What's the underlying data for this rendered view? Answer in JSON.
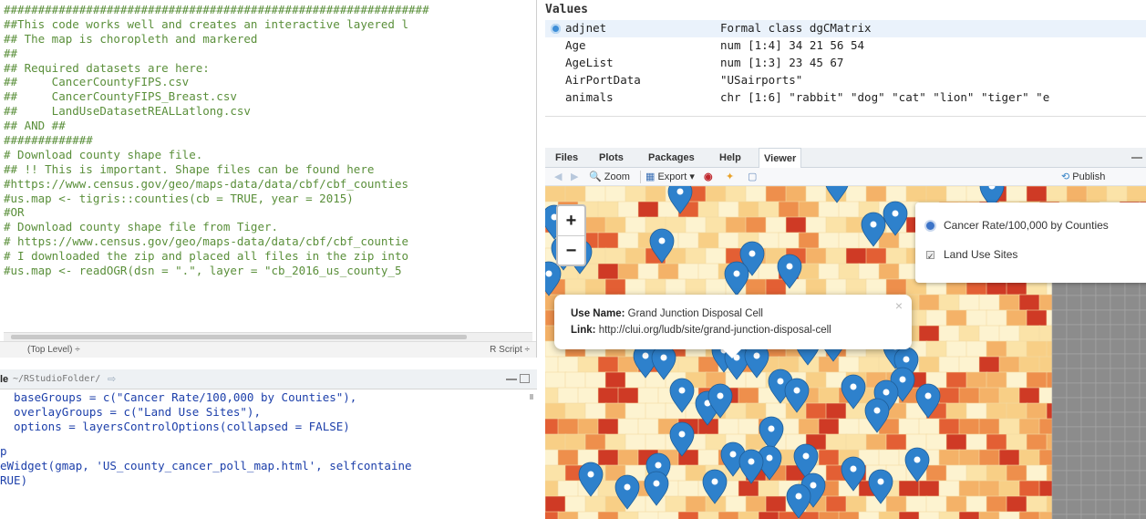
{
  "editor": {
    "lines": [
      "##############################################################",
      "##This code works well and creates an interactive layered l",
      "## The map is choropleth and markered",
      "##",
      "## Required datasets are here:",
      "##     CancerCountyFIPS.csv",
      "##     CancerCountyFIPS_Breast.csv",
      "##     LandUseDatasetREALLatlong.csv",
      "## AND ##",
      "#############",
      "# Download county shape file.",
      "## !! This is important. Shape files can be found here",
      "#https://www.census.gov/geo/maps-data/data/cbf/cbf_counties",
      "#us.map <- tigris::counties(cb = TRUE, year = 2015)",
      "#OR",
      "# Download county shape file from Tiger.",
      "# https://www.census.gov/geo/maps-data/data/cbf/cbf_countie",
      "# I downloaded the zip and placed all files in the zip into",
      "#us.map <- readOGR(dsn = \".\", layer = \"cb_2016_us_county_5"
    ],
    "scope": "(Top Level) ÷",
    "file_type": "R Script ÷"
  },
  "console": {
    "title": "le",
    "path": "~/RStudioFolder/",
    "lines_a": [
      "  baseGroups = c(\"Cancer Rate/100,000 by Counties\"),",
      "  overlayGroups = c(\"Land Use Sites\"),",
      "  options = layersControlOptions(collapsed = FALSE)"
    ],
    "lines_b": [
      "p",
      "eWidget(gmap, 'US_county_cancer_poll_map.html', selfcontaine",
      "RUE)"
    ]
  },
  "environment": {
    "header": "Values",
    "rows": [
      {
        "name": "adjnet",
        "value": "Formal class dgCMatrix"
      },
      {
        "name": "Age",
        "value": "num [1:4] 34 21 56 54"
      },
      {
        "name": "AgeList",
        "value": "num [1:3] 23 45 67"
      },
      {
        "name": "AirPortData",
        "value": "\"USairports\""
      },
      {
        "name": "animals",
        "value": "chr [1:6] \"rabbit\" \"dog\" \"cat\" \"lion\" \"tiger\" \"e"
      }
    ]
  },
  "viewer": {
    "tabs": [
      "Files",
      "Plots",
      "Packages",
      "Help",
      "Viewer"
    ],
    "active_tab": "Viewer",
    "toolbar": {
      "zoom": "Zoom",
      "export": "Export",
      "publish": "Publish"
    }
  },
  "map": {
    "zoom_in": "+",
    "zoom_out": "−",
    "layers": {
      "base": "Cancer Rate/100,000 by Counties",
      "overlay": "Land Use Sites"
    },
    "popup": {
      "use_name_label": "Use Name:",
      "use_name": "Grand Junction Disposal Cell",
      "link_label": "Link:",
      "link": "http://clui.org/ludb/site/grand-junction-disposal-cell",
      "close": "×"
    },
    "colors": {
      "marker": "#2e81cc",
      "choropleth": [
        "#fdf3d0",
        "#fbe3a8",
        "#f8cf86",
        "#f4b268",
        "#ee8f4c",
        "#e35f34",
        "#cf3a25"
      ],
      "no_data": "#8c8c8c"
    }
  }
}
